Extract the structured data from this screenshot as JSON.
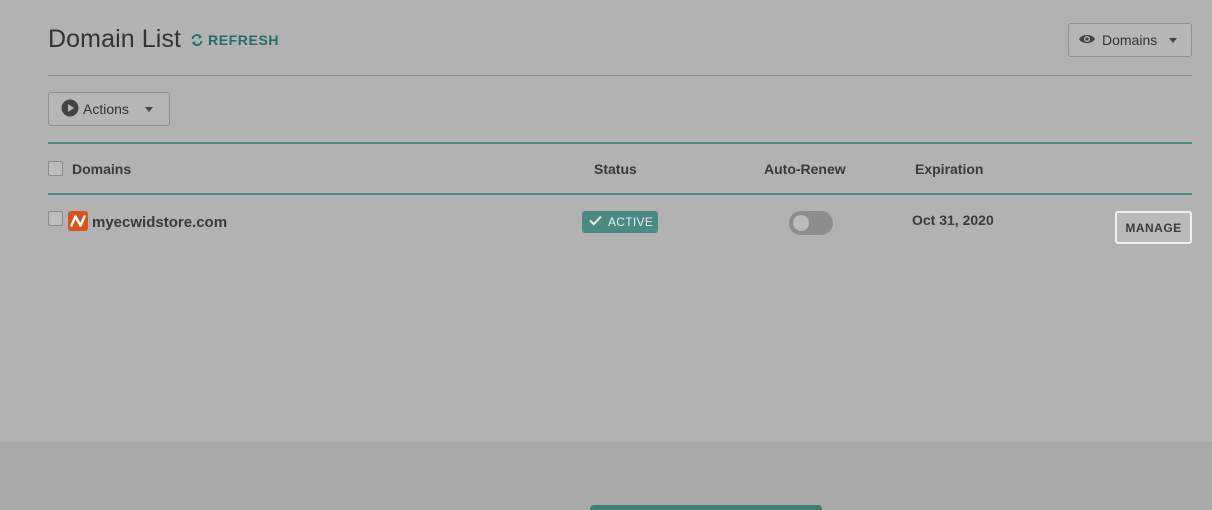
{
  "header": {
    "title": "Domain List",
    "refresh_label": "REFRESH",
    "view_dropdown_label": "Domains"
  },
  "toolbar": {
    "actions_label": "Actions"
  },
  "table": {
    "columns": [
      "Domains",
      "Status",
      "Auto-Renew",
      "Expiration"
    ],
    "rows": [
      {
        "domain": "myecwidstore.com",
        "status": "ACTIVE",
        "auto_renew": false,
        "expiration": "Oct 31, 2020",
        "action_label": "MANAGE"
      }
    ]
  },
  "icons": {
    "refresh": "refresh-icon",
    "view": "eye-icon",
    "actions": "play-circle-icon",
    "status": "checkmark-icon",
    "registrar": "namecheap-logo-icon"
  },
  "colors": {
    "accent": "#1f6f66",
    "badge": "#4a8a82",
    "registrar_logo": "#d4551c",
    "overlay_bg": "#b2b2b2"
  }
}
